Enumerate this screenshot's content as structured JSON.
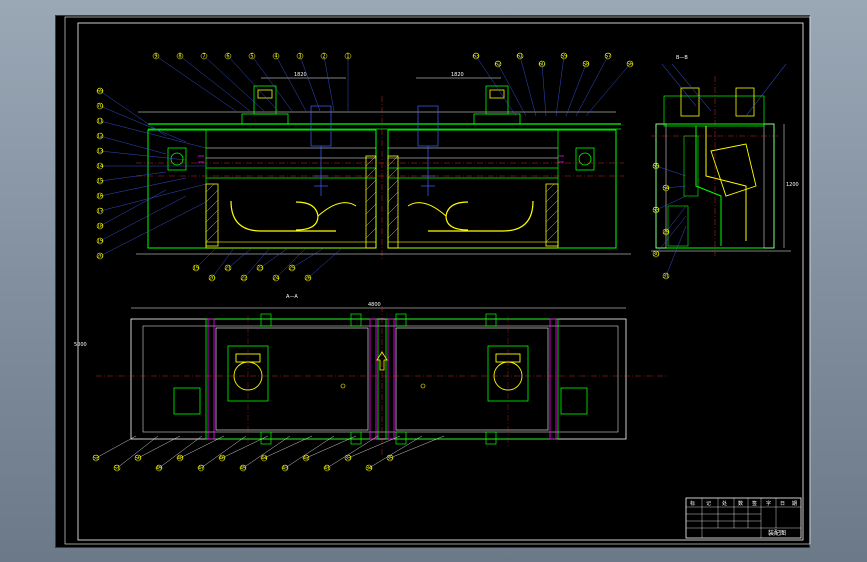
{
  "drawing": {
    "title_block": {
      "headers": [
        "标",
        "记",
        "处",
        "数",
        "签",
        "字",
        "日",
        "期"
      ],
      "name": "装配图"
    },
    "views": {
      "top_label": "A—A",
      "section_label": "B—B"
    },
    "balloons": {
      "left_column": [
        "69",
        "70",
        "11",
        "12",
        "13",
        "14",
        "15",
        "16",
        "17",
        "18",
        "19",
        "20"
      ],
      "top_row": [
        "9",
        "8",
        "7",
        "6",
        "5",
        "4",
        "3",
        "2",
        "1"
      ],
      "right_top": [
        "63",
        "62",
        "61",
        "60",
        "59",
        "58",
        "57",
        "56"
      ],
      "bottom_row": [
        "19",
        "20",
        "21",
        "22",
        "23",
        "24",
        "25",
        "26"
      ],
      "plan_bottom": [
        "52",
        "51",
        "50",
        "49",
        "48",
        "47",
        "46",
        "45",
        "44",
        "43",
        "42",
        "41",
        "33",
        "34",
        "35"
      ],
      "section_side": [
        "55",
        "54",
        "53",
        "29",
        "30",
        "31"
      ]
    },
    "dimensions": {
      "overall_width": "5000",
      "span_left": "1820",
      "span_right": "1820",
      "plan_length": "4800",
      "height": "1200"
    }
  }
}
